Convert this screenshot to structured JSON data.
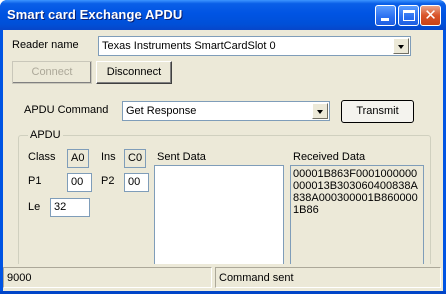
{
  "window": {
    "title": "Smart card Exchange APDU",
    "close_glyph": "✕"
  },
  "reader": {
    "label": "Reader name",
    "selected": "Texas Instruments SmartCardSlot 0"
  },
  "buttons": {
    "connect": "Connect",
    "disconnect": "Disconnect",
    "transmit": "Transmit"
  },
  "apdu_command": {
    "label": "APDU Command",
    "selected": "Get Response"
  },
  "apdu_group": {
    "title": "APDU",
    "class_label": "Class",
    "class_value": "A0",
    "ins_label": "Ins",
    "ins_value": "C0",
    "p1_label": "P1",
    "p1_value": "00",
    "p2_label": "P2",
    "p2_value": "00",
    "le_label": "Le",
    "le_value": "32",
    "sent_label": "Sent Data",
    "sent_value": "",
    "received_label": "Received Data",
    "received_value": "00001B863F0001000000000013B303060400838A838A000300001B8600001B86"
  },
  "status": {
    "sw": "9000",
    "message": "Command sent"
  },
  "colors": {
    "titlebar": "#0054e3",
    "dialog_bg": "#ece9d8",
    "field_border": "#7f9db9",
    "disabled_text": "#aca899"
  },
  "icons": {
    "minimize": "minimize-icon",
    "maximize": "maximize-icon",
    "close": "close-icon",
    "dropdown": "chevron-down-icon"
  }
}
